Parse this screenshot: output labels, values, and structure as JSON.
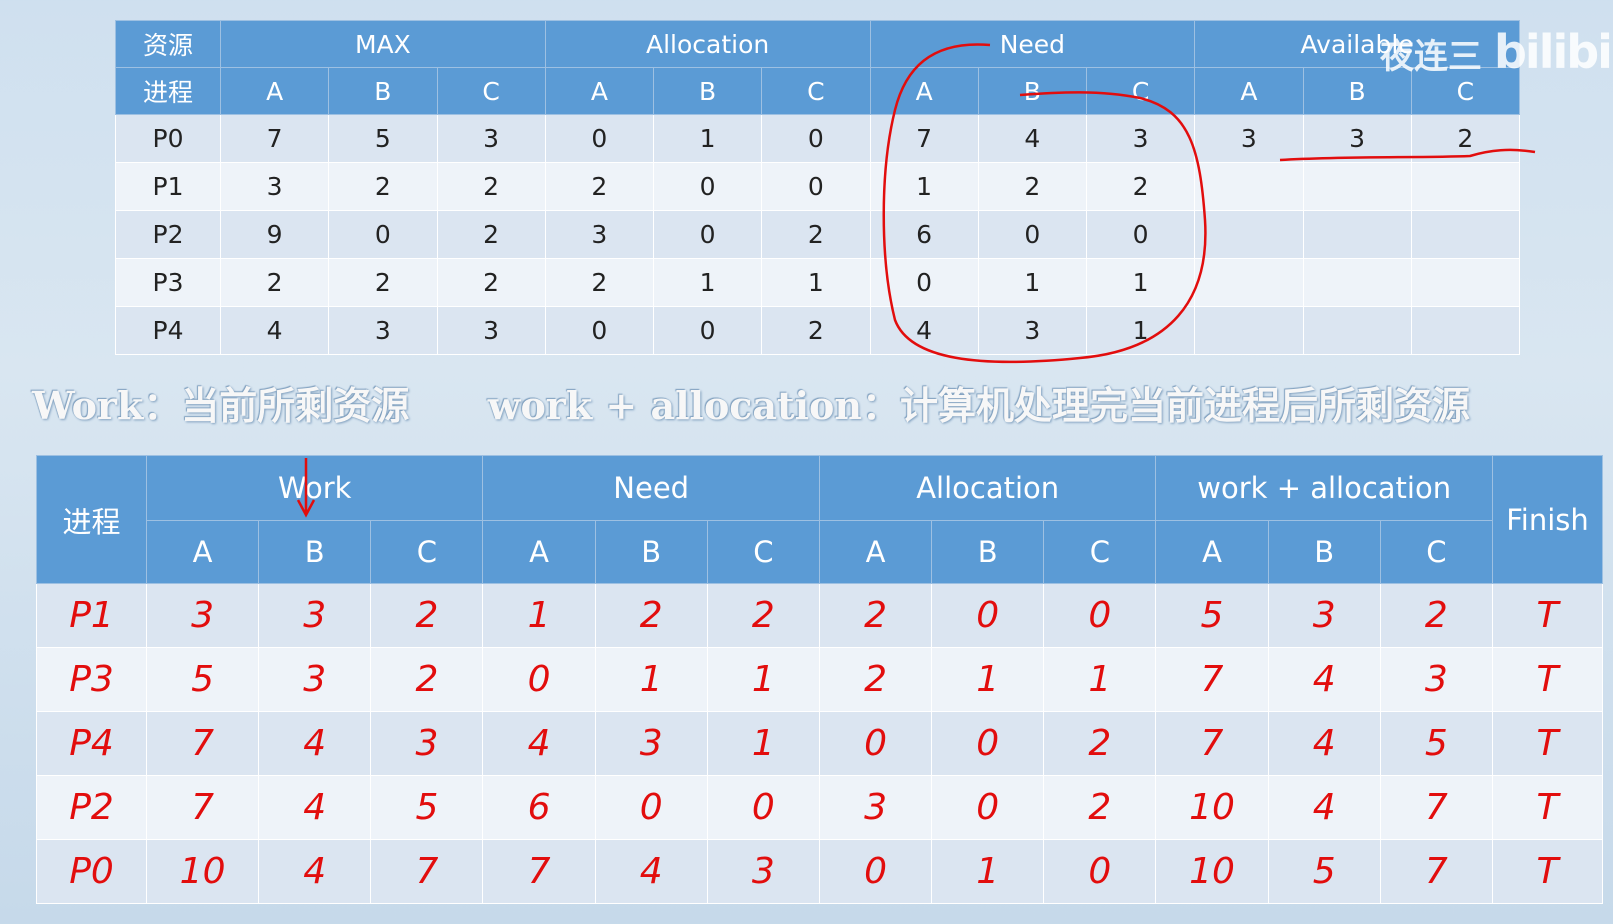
{
  "top_table": {
    "header_row1": [
      "资源",
      "MAX",
      "Allocation",
      "Need",
      "Available"
    ],
    "header_row2_first": "进程",
    "sub_headers": [
      "A",
      "B",
      "C",
      "A",
      "B",
      "C",
      "A",
      "B",
      "C",
      "A",
      "B",
      "C"
    ],
    "rows": [
      {
        "process": "P0",
        "values": [
          "7",
          "5",
          "3",
          "0",
          "1",
          "0",
          "7",
          "4",
          "3",
          "3",
          "3",
          "2"
        ]
      },
      {
        "process": "P1",
        "values": [
          "3",
          "2",
          "2",
          "2",
          "0",
          "0",
          "1",
          "2",
          "2",
          "",
          "",
          ""
        ]
      },
      {
        "process": "P2",
        "values": [
          "9",
          "0",
          "2",
          "3",
          "0",
          "2",
          "6",
          "0",
          "0",
          "",
          "",
          ""
        ]
      },
      {
        "process": "P3",
        "values": [
          "2",
          "2",
          "2",
          "2",
          "1",
          "1",
          "0",
          "1",
          "1",
          "",
          "",
          ""
        ]
      },
      {
        "process": "P4",
        "values": [
          "4",
          "3",
          "3",
          "0",
          "0",
          "2",
          "4",
          "3",
          "1",
          "",
          "",
          ""
        ]
      }
    ]
  },
  "caption": {
    "left": "Work：当前所剩资源",
    "right": "work + allocation：计算机处理完当前进程后所剩资源"
  },
  "bottom_table": {
    "process_header": "进程",
    "group_headers": [
      "Work",
      "Need",
      "Allocation",
      "work + allocation"
    ],
    "finish_header": "Finish",
    "sub_headers": [
      "A",
      "B",
      "C",
      "A",
      "B",
      "C",
      "A",
      "B",
      "C",
      "A",
      "B",
      "C"
    ],
    "rows": [
      {
        "process": "P1",
        "values": [
          "3",
          "3",
          "2",
          "1",
          "2",
          "2",
          "2",
          "0",
          "0",
          "5",
          "3",
          "2"
        ],
        "finish": "T"
      },
      {
        "process": "P3",
        "values": [
          "5",
          "3",
          "2",
          "0",
          "1",
          "1",
          "2",
          "1",
          "1",
          "7",
          "4",
          "3"
        ],
        "finish": "T"
      },
      {
        "process": "P4",
        "values": [
          "7",
          "4",
          "3",
          "4",
          "3",
          "1",
          "0",
          "0",
          "2",
          "7",
          "4",
          "5"
        ],
        "finish": "T"
      },
      {
        "process": "P2",
        "values": [
          "7",
          "4",
          "5",
          "6",
          "0",
          "0",
          "3",
          "0",
          "2",
          "10",
          "4",
          "7"
        ],
        "finish": "T"
      },
      {
        "process": "P0",
        "values": [
          "10",
          "4",
          "7",
          "7",
          "4",
          "3",
          "0",
          "1",
          "0",
          "10",
          "5",
          "7"
        ],
        "finish": "T"
      }
    ]
  },
  "watermark": {
    "text": "夜连三",
    "logo": "bilibili"
  },
  "colors": {
    "header_blue": "#5b9bd5",
    "ink_red": "#e20d0d"
  }
}
